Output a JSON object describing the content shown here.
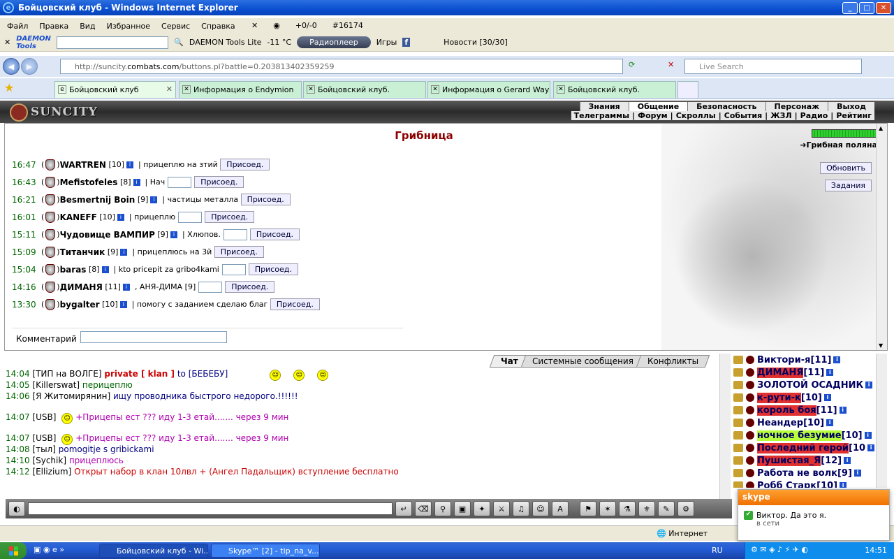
{
  "window": {
    "title": "Бойцовский клуб - Windows Internet Explorer"
  },
  "menu": {
    "items": [
      "Файл",
      "Правка",
      "Вид",
      "Избранное",
      "Сервис",
      "Справка"
    ],
    "counter": "+0/-0",
    "id": "#16174"
  },
  "toolbar": {
    "daemon": "DAEMON Tools",
    "daemon_lite": "DAEMON Tools Lite",
    "weather": "-11 °C",
    "radio": "Радиоплеер",
    "games": "Игры",
    "news": "Новости [30/30]"
  },
  "address": {
    "url_prefix": "http://suncity.",
    "url_domain": "combats.com",
    "url_rest": "/buttons.pl?battle=0.203813402359259",
    "search_placeholder": "Live Search"
  },
  "tabs": [
    {
      "label": "Бойцовский клуб"
    },
    {
      "label": "Информация о Endymion"
    },
    {
      "label": "Бойцовский клуб."
    },
    {
      "label": "Информация о Gerard Way"
    },
    {
      "label": "Бойцовский клуб."
    }
  ],
  "game": {
    "logo": "SUNCITY",
    "nav1": [
      "Знания",
      "Общение",
      "Безопасность",
      "Персонаж",
      "Выход"
    ],
    "nav2": [
      "Телеграммы",
      "Форум",
      "Скроллы",
      "События",
      "ЖЗЛ",
      "Радио",
      "Рейтинг"
    ],
    "page_title": "Грибница",
    "location": "Грибная поляна",
    "refresh": "Обновить",
    "tasks": "Задания",
    "join_label": "Присоед.",
    "comment_label": "Комментарий"
  },
  "bids": [
    {
      "time": "16:47",
      "nick": "WARTREN",
      "level": "[10]",
      "comment": "| прицеплю на зтий",
      "input": false
    },
    {
      "time": "16:43",
      "nick": "Mefistofeles",
      "level": "[8]",
      "comment": "| Нач",
      "input": true
    },
    {
      "time": "16:21",
      "nick": "Besmertnij Boin",
      "level": "[9]",
      "comment": "| частицы металла",
      "input": false
    },
    {
      "time": "16:01",
      "nick": "KANEFF",
      "level": "[10]",
      "comment": "| прицеплю",
      "input": true
    },
    {
      "time": "15:11",
      "nick": "Чудовище ВАМПИР",
      "level": "[9]",
      "comment": "| Хлюпов.",
      "input": true
    },
    {
      "time": "15:09",
      "nick": "Титанчик",
      "level": "[9]",
      "comment": "| прицеплюсь на 3й",
      "input": false
    },
    {
      "time": "15:04",
      "nick": "baras",
      "level": "[8]",
      "comment": "| kto pricepit za gribo4kami",
      "input": true
    },
    {
      "time": "14:16",
      "nick": "ДИМАНЯ",
      "level": "[11]",
      "comment": ", АНЯ-ДИМА [9]",
      "input": true
    },
    {
      "time": "13:30",
      "nick": "bygalter",
      "level": "[10]",
      "comment": "| помогу с заданием сделаю благ",
      "input": false
    }
  ],
  "chat_tabs": [
    "Чат",
    "Системные сообщения",
    "Конфликты"
  ],
  "chat": [
    {
      "time": "14:04",
      "nick": "ТИП на ВОЛГЕ",
      "private": "private [ klan ]",
      "to": "to",
      "target": "[БЕБЕБУ]"
    },
    {
      "time": "14:05",
      "nick": "Killerswat",
      "text": "перицеплю",
      "cls": "green"
    },
    {
      "time": "14:06",
      "nick": "Я Житомирянин",
      "text": "ищу проводника быстрого недорого.!!!!!!",
      "cls": "navy"
    },
    {
      "time": "14:07",
      "nick": "USB",
      "text": "+Прицепы ест ??? иду 1-3 етай....... через 9 мин",
      "cls": "purple",
      "smile": true
    },
    {
      "time": "14:07",
      "nick": "USB",
      "text": "+Прицепы ест ??? иду 1-3 етай....... через 9 мин",
      "cls": "purple",
      "smile": true
    },
    {
      "time": "14:08",
      "nick": "тыл",
      "text": "pomogitje s gribickami",
      "cls": "navy"
    },
    {
      "time": "14:10",
      "nick": "Sychik",
      "text": "прицеплюсь",
      "cls": "purple"
    },
    {
      "time": "14:12",
      "nick": "Ellizium",
      "text": "Открыт набор в клан 10лвл + (Ангел Падальщик) вступление бесплатно",
      "cls": "red"
    }
  ],
  "users": [
    {
      "name": "Виктори-я",
      "level": "[11]",
      "hl": ""
    },
    {
      "name": "ДИМАНЯ",
      "level": "[11]",
      "hl": "red"
    },
    {
      "name": "ЗОЛОТОЙ ОСАДНИК",
      "level": "",
      "hl": ""
    },
    {
      "name": "к-рути-к",
      "level": "[10]",
      "hl": "red"
    },
    {
      "name": "король боя",
      "level": "[11]",
      "hl": "red"
    },
    {
      "name": "Неандер",
      "level": "[10]",
      "hl": ""
    },
    {
      "name": "ночное безумие",
      "level": "[10]",
      "hl": "green"
    },
    {
      "name": "Последний герой",
      "level": "[10",
      "hl": "red"
    },
    {
      "name": "Пушистая_Я",
      "level": "[12]",
      "hl": "red"
    },
    {
      "name": "Работа не волк",
      "level": "[9]",
      "hl": ""
    },
    {
      "name": "Робб Старк",
      "level": "[10]",
      "hl": ""
    }
  ],
  "status": {
    "zone": "Интернет"
  },
  "skype_popup": {
    "title": "skype",
    "message": "Виктор. Да это я.",
    "status": "в сети"
  },
  "taskbar": {
    "btn1": "Бойцовский клуб - Wi...",
    "btn2": "Skype™ [2] - tip_na_v...",
    "lang": "RU",
    "clock": "14:51"
  }
}
